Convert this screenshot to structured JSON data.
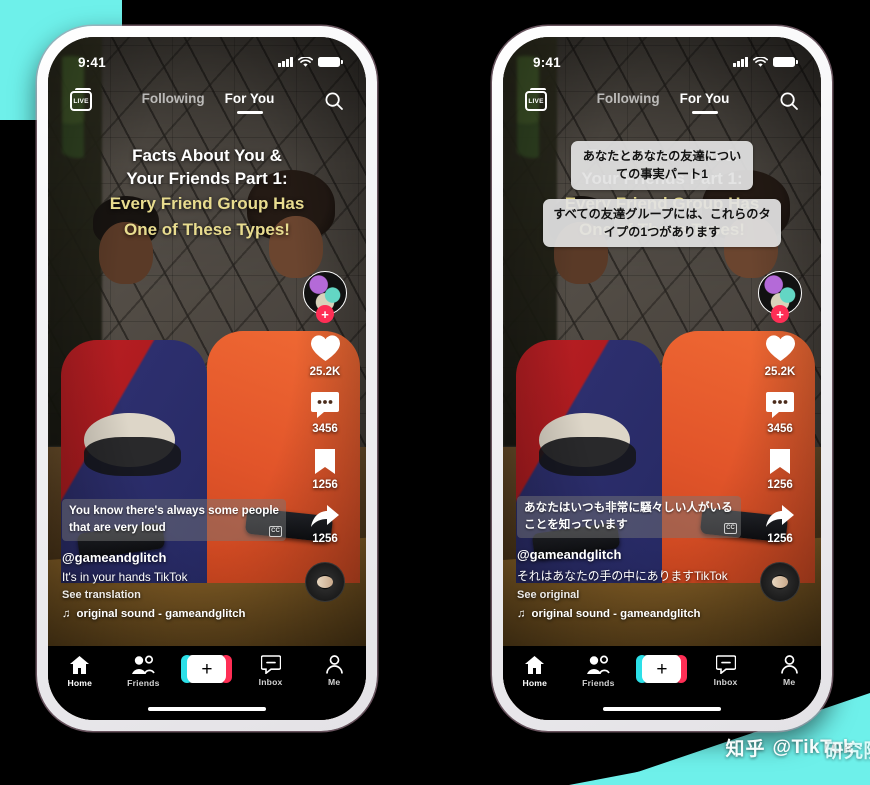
{
  "colors": {
    "teal": "#6EF0EA",
    "background": "#000000",
    "tiktok_red": "#FF2E55",
    "tiktok_cyan": "#2CE0E8",
    "overlay_yellow": "#E8DC8F"
  },
  "phones": [
    {
      "id": "original",
      "status_bar": {
        "clock": "9:41",
        "signal": "cellular-bars-icon",
        "wifi": "wifi-icon",
        "battery": "battery-full-icon"
      },
      "top_nav": {
        "live_label": "LIVE",
        "tabs": [
          {
            "label": "Following",
            "active": false
          },
          {
            "label": "For You",
            "active": true
          }
        ],
        "search_icon": "search-icon"
      },
      "overlay_text": {
        "white_lines": [
          "Facts About You &",
          "Your Friends Part 1:"
        ],
        "yellow_lines": [
          "Every Friend Group Has",
          "One of These Types!"
        ]
      },
      "translated_bubbles": [],
      "caption": {
        "subtitle": "You know there's always some people that are very loud",
        "cc_badge": "CC",
        "handle": "@gameandglitch",
        "description": "It's in your hands TikTok",
        "translate_link": "See translation",
        "sound": "original sound - gameandglitch",
        "music_icon": "music-note-icon"
      },
      "rail": {
        "avatar": "creator-avatar",
        "follow_badge": "+",
        "like": {
          "icon": "heart-icon",
          "count": "25.2K"
        },
        "comment": {
          "icon": "comment-icon",
          "count": "3456"
        },
        "bookmark": {
          "icon": "bookmark-icon",
          "count": "1256"
        },
        "share": {
          "icon": "share-arrow-icon",
          "count": "1256"
        },
        "disc": "music-disc-icon"
      },
      "tab_bar": [
        {
          "label": "Home",
          "icon": "home-icon",
          "active": true
        },
        {
          "label": "Friends",
          "icon": "friends-icon",
          "active": false
        },
        {
          "label": "",
          "icon": "create-plus-icon",
          "active": false
        },
        {
          "label": "Inbox",
          "icon": "inbox-icon",
          "active": false
        },
        {
          "label": "Me",
          "icon": "person-icon",
          "active": false
        }
      ]
    },
    {
      "id": "translated",
      "status_bar": {
        "clock": "9:41",
        "signal": "cellular-bars-icon",
        "wifi": "wifi-icon",
        "battery": "battery-full-icon"
      },
      "top_nav": {
        "live_label": "LIVE",
        "tabs": [
          {
            "label": "Following",
            "active": false
          },
          {
            "label": "For You",
            "active": true
          }
        ],
        "search_icon": "search-icon"
      },
      "overlay_text": {
        "white_lines": [
          "Facts About You &",
          "Your Friends Part 1:"
        ],
        "yellow_lines": [
          "Every Friend Group Has",
          "One of These Types!"
        ]
      },
      "translated_bubbles": [
        "あなたとあなたの友達についての事実パート1",
        "すべての友達グループには、これらのタイプの1つがあります"
      ],
      "caption": {
        "subtitle": "あなたはいつも非常に騒々しい人がいることを知っています",
        "cc_badge": "CC",
        "handle": "@gameandglitch",
        "description": "それはあなたの手の中にありますTikTok",
        "translate_link": "See original",
        "sound": "original sound - gameandglitch",
        "music_icon": "music-note-icon"
      },
      "rail": {
        "avatar": "creator-avatar",
        "follow_badge": "+",
        "like": {
          "icon": "heart-icon",
          "count": "25.2K"
        },
        "comment": {
          "icon": "comment-icon",
          "count": "3456"
        },
        "bookmark": {
          "icon": "bookmark-icon",
          "count": "1256"
        },
        "share": {
          "icon": "share-arrow-icon",
          "count": "1256"
        },
        "disc": "music-disc-icon"
      },
      "tab_bar": [
        {
          "label": "Home",
          "icon": "home-icon",
          "active": true
        },
        {
          "label": "Friends",
          "icon": "friends-icon",
          "active": false
        },
        {
          "label": "",
          "icon": "create-plus-icon",
          "active": false
        },
        {
          "label": "Inbox",
          "icon": "inbox-icon",
          "active": false
        },
        {
          "label": "Me",
          "icon": "person-icon",
          "active": false
        }
      ]
    }
  ],
  "watermark": {
    "site": "知乎",
    "handle": "@TikTok",
    "overlay_text": "研究院院眠",
    "logo": "zhihu-logo-icon"
  }
}
